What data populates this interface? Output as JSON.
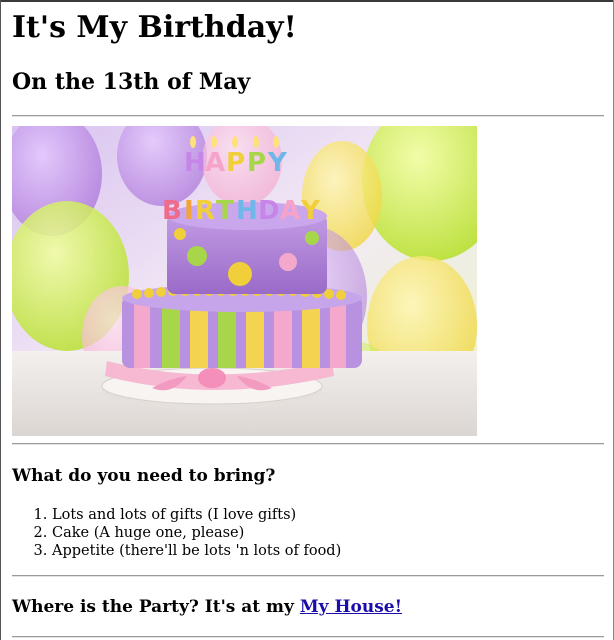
{
  "page": {
    "title": "It's My Birthday!",
    "subtitle": "On the 13th of May"
  },
  "image": {
    "alt": "Birthday cake with candles spelling HAPPY BIRTHDAY",
    "candle_words": [
      "HAPPY",
      "BIRTHDAY"
    ],
    "colors": {
      "purple": "#b58fd6",
      "yellow": "#f1d25a",
      "green": "#a7d24c",
      "pink": "#f5b7cf"
    }
  },
  "bring": {
    "heading": "What do you need to bring?",
    "items": [
      "Lots and lots of gifts (I love gifts)",
      "Cake (A huge one, please)",
      "Appetite (there'll be lots 'n lots of food)"
    ]
  },
  "location": {
    "heading_prefix": "Where is the Party? It's at my ",
    "link_text": "My House!"
  }
}
